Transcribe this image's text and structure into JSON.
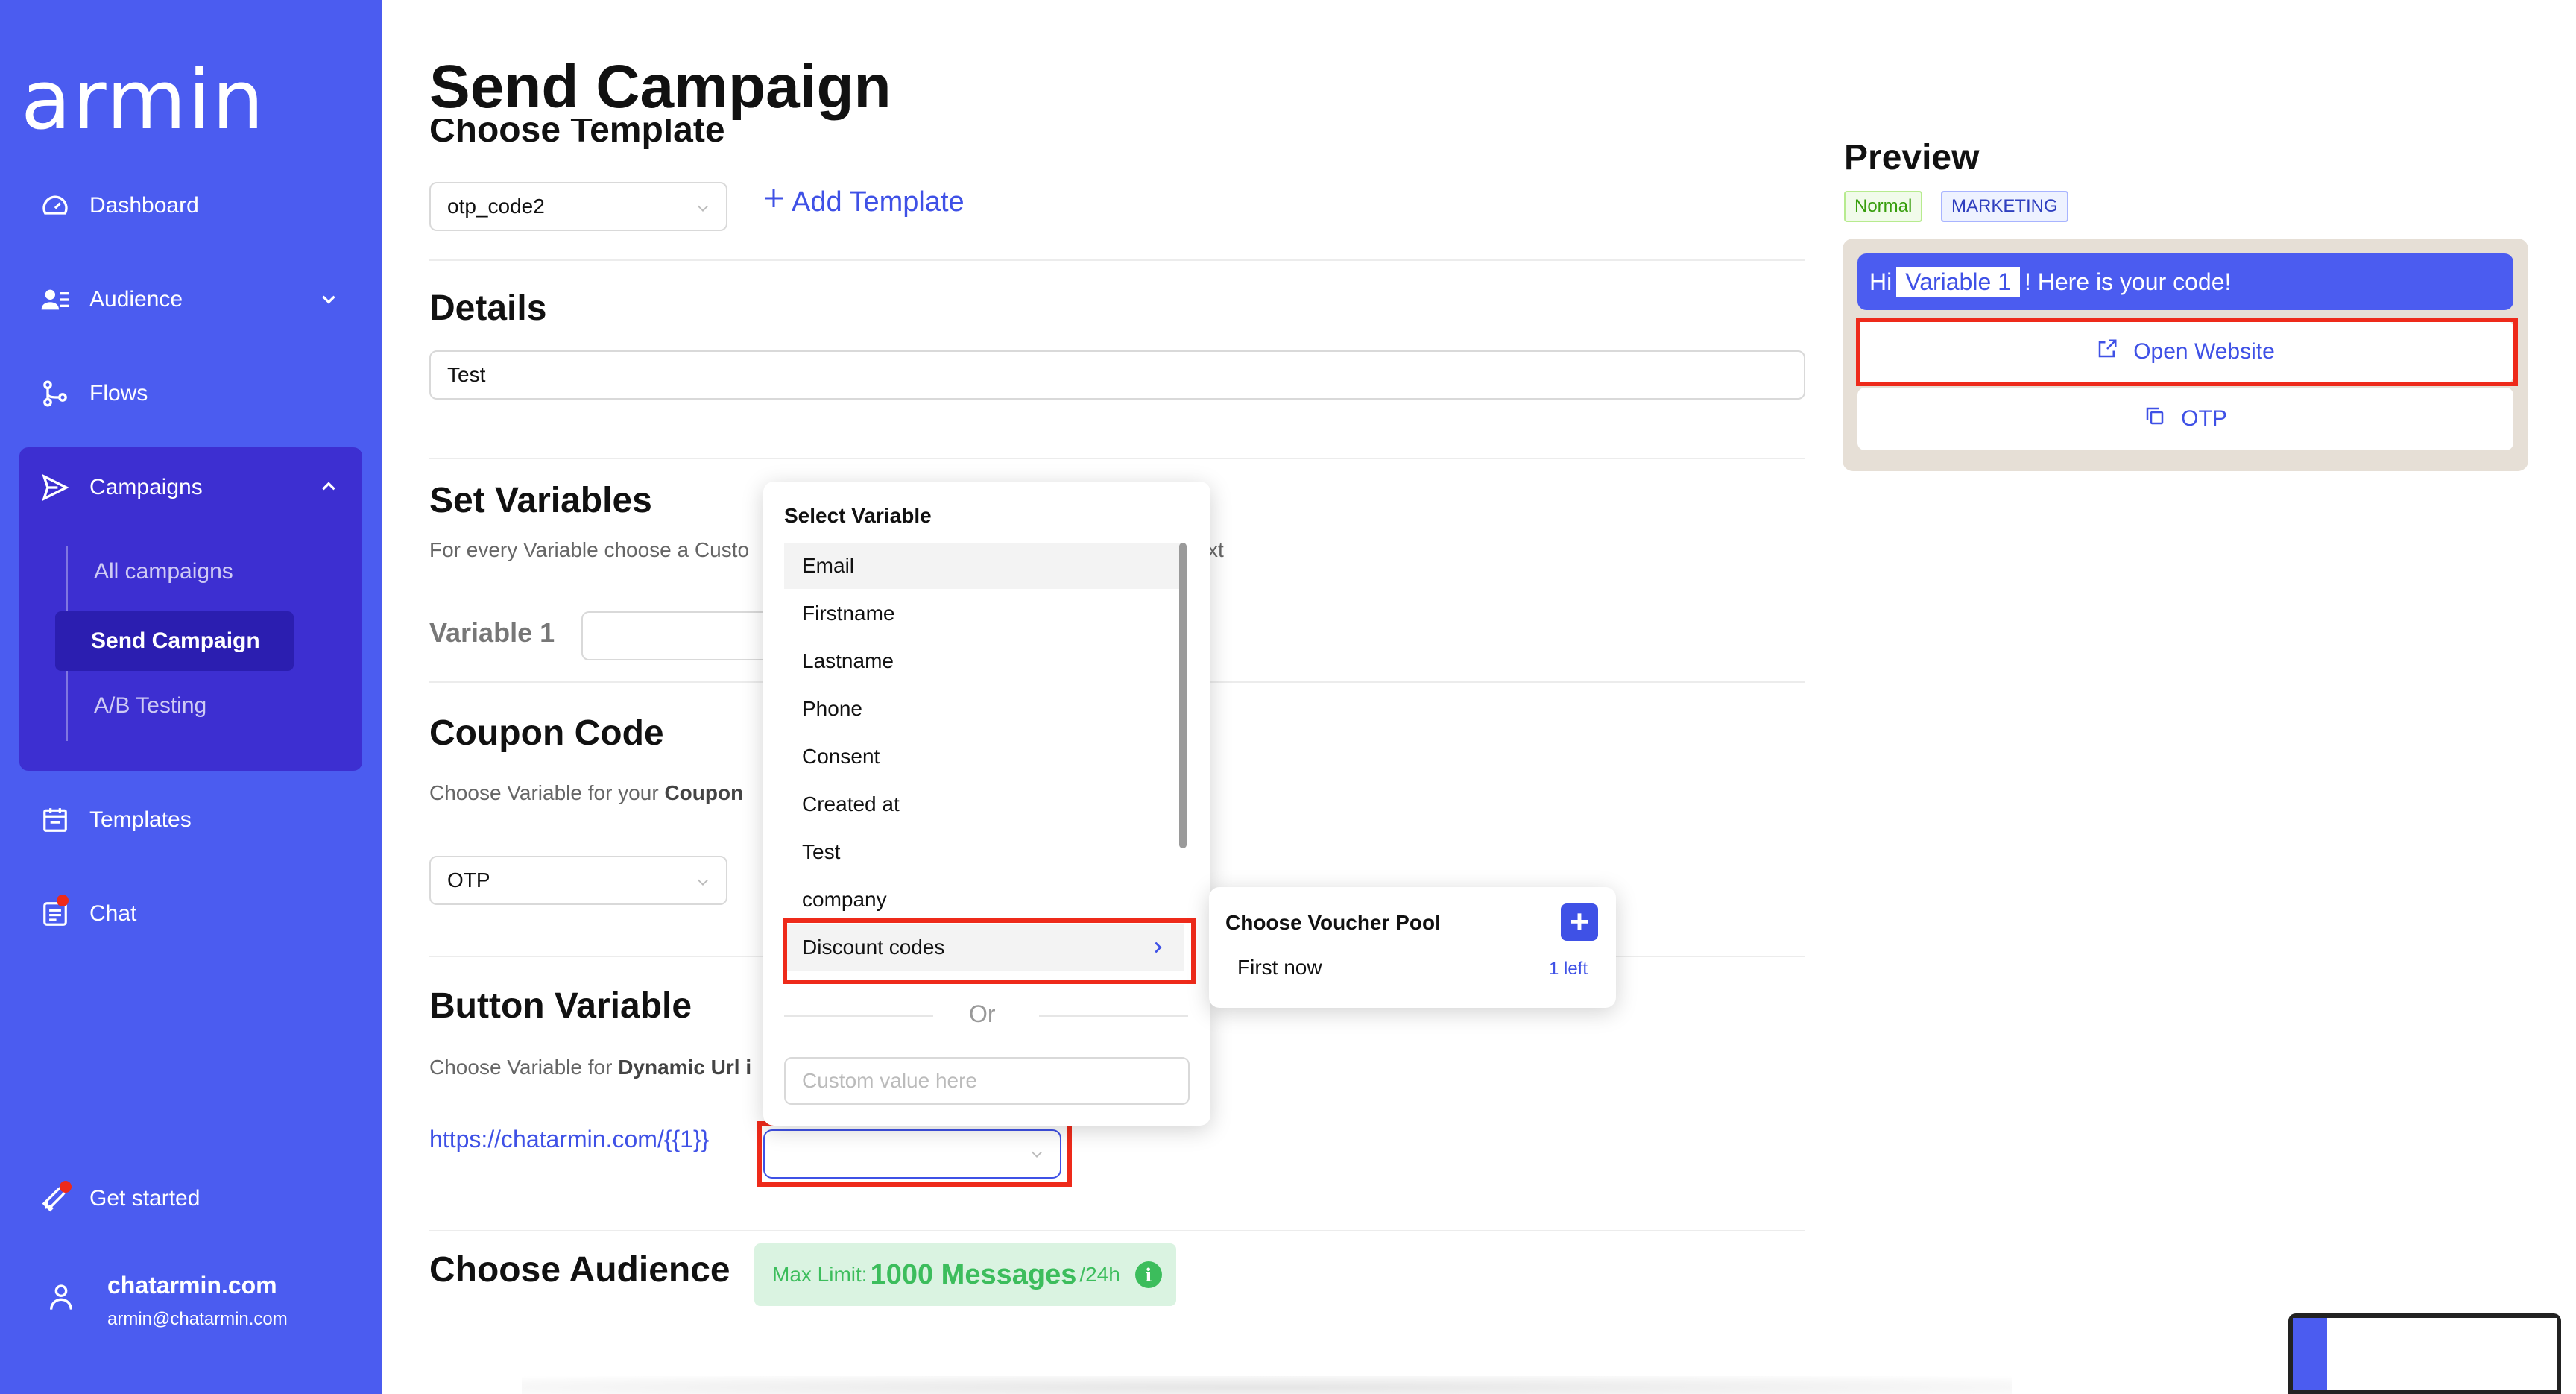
{
  "app": {
    "logo": "armin"
  },
  "sidebar": {
    "items": [
      {
        "label": "Dashboard",
        "icon": "gauge-icon"
      },
      {
        "label": "Audience",
        "icon": "users-icon"
      },
      {
        "label": "Flows",
        "icon": "flows-icon"
      },
      {
        "label": "Campaigns",
        "icon": "send-icon"
      },
      {
        "label": "Templates",
        "icon": "calendar-icon"
      },
      {
        "label": "Chat",
        "icon": "chat-icon"
      }
    ],
    "campaign_sub": [
      "All campaigns",
      "Send Campaign",
      "A/B Testing"
    ],
    "get_started": "Get started",
    "profile": {
      "name": "chatarmin.com",
      "email": "armin@chatarmin.com"
    },
    "colors": {
      "bg": "#4b5cf0",
      "active_group": "#3d2fd1",
      "active_item": "#2b1eb0"
    }
  },
  "page": {
    "title": "Send Campaign",
    "choose_template": {
      "heading": "Choose Template",
      "selected": "otp_code2",
      "add_label": "Add Template"
    },
    "details": {
      "heading": "Details",
      "value": "Test"
    },
    "set_variables": {
      "heading": "Set Variables",
      "description_start": "For every Variable choose a Custo",
      "description_end": "xt",
      "variable_label": "Variable 1"
    },
    "coupon": {
      "heading": "Coupon Code",
      "description": "Choose Variable for your ",
      "description_bold": "Coupon",
      "selected": "OTP"
    },
    "button_variable": {
      "heading": "Button Variable",
      "description": "Choose Variable for ",
      "description_bold": "Dynamic Url i",
      "url": "https://chatarmin.com/{{1}}"
    },
    "audience": {
      "heading": "Choose Audience",
      "limit_prefix": "Max Limit:",
      "limit_value": "1000 Messages",
      "limit_suffix": "/24h"
    }
  },
  "dropdown": {
    "title": "Select Variable",
    "options": [
      "Email",
      "Firstname",
      "Lastname",
      "Phone",
      "Consent",
      "Created at",
      "Test",
      "company",
      "Discount codes"
    ],
    "or": "Or",
    "custom_placeholder": "Custom value here"
  },
  "voucher_pool": {
    "title": "Choose Voucher Pool",
    "item": "First now",
    "left": "1 left"
  },
  "preview": {
    "title": "Preview",
    "tags": [
      "Normal",
      "MARKETING"
    ],
    "message_start": "Hi",
    "message_var": "Variable 1",
    "message_end": "! Here is your code!",
    "buttons": [
      "Open Website",
      "OTP"
    ]
  }
}
